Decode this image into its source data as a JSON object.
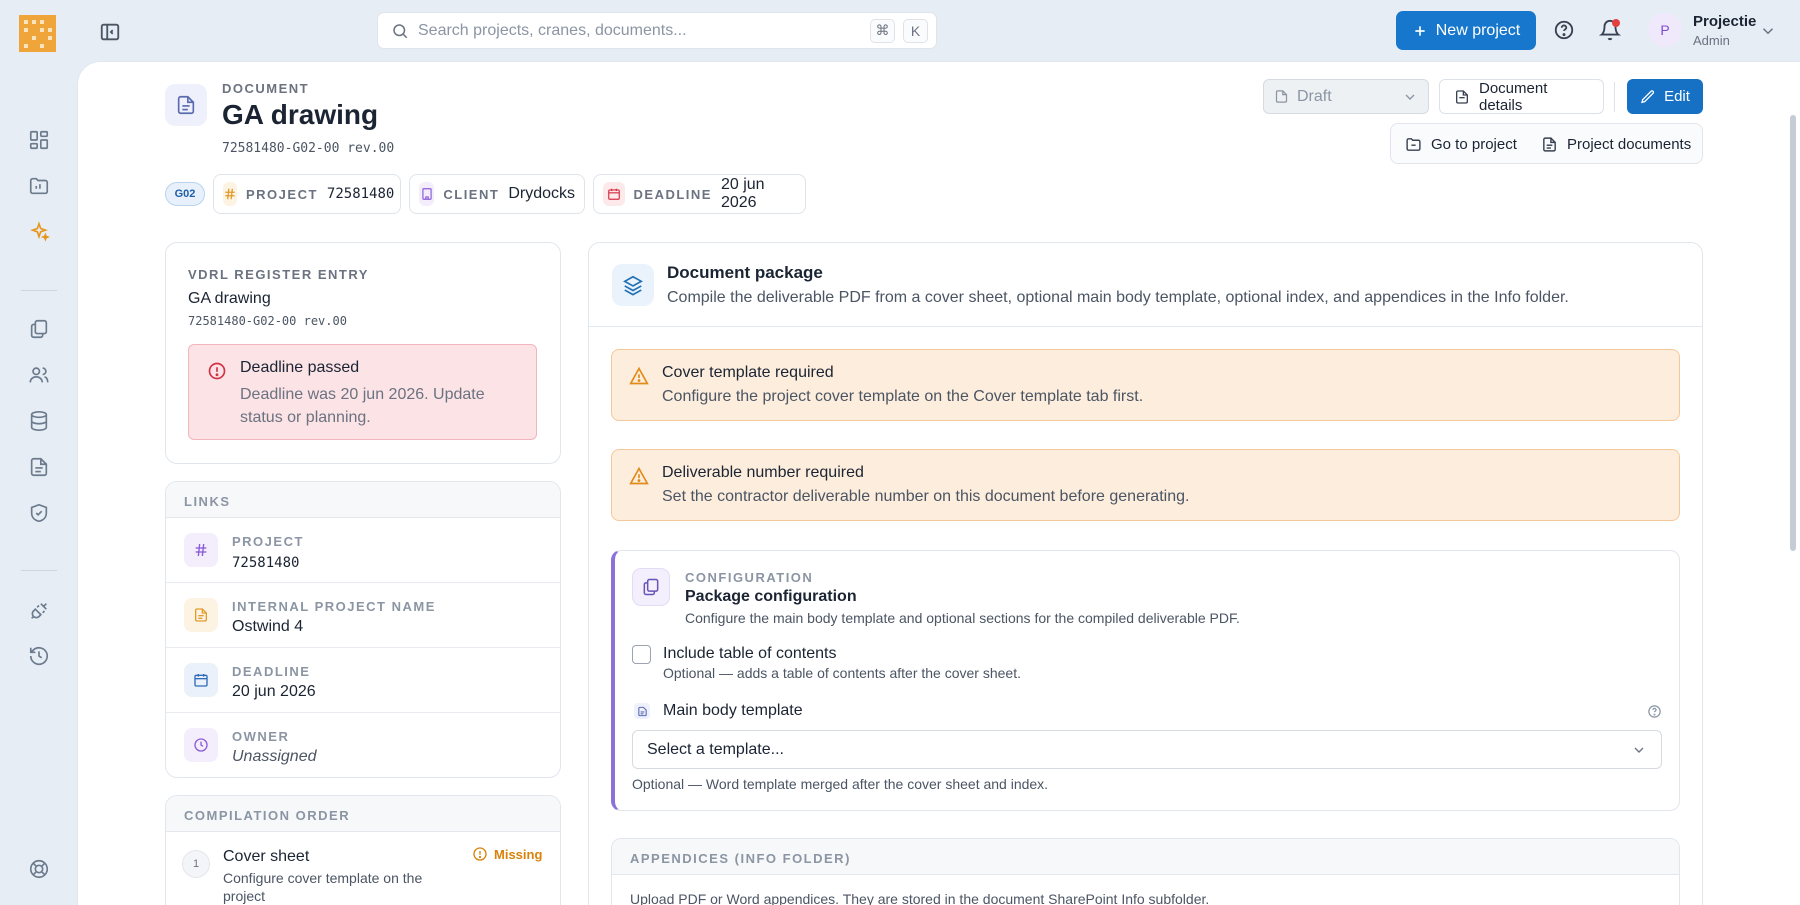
{
  "topbar": {
    "search_placeholder": "Search projects, cranes, documents...",
    "kbd_cmd": "⌘",
    "kbd_k": "K",
    "new_project_label": "New project",
    "user_initial": "P",
    "user_name": "Projectie",
    "user_role": "Admin"
  },
  "document": {
    "eyebrow": "DOCUMENT",
    "title": "GA drawing",
    "code": "72581480-G02-00 rev.00",
    "status": "Draft",
    "details_label": "Document details",
    "edit_label": "Edit",
    "goto_project_label": "Go to project",
    "project_documents_label": "Project documents"
  },
  "chips": {
    "code": "G02",
    "project_label": "PROJECT",
    "project_value": "72581480",
    "client_label": "CLIENT",
    "client_value": "Drydocks",
    "deadline_label": "DEADLINE",
    "deadline_value": "20 jun 2026"
  },
  "vdrl": {
    "eyebrow": "VDRL REGISTER ENTRY",
    "title": "GA drawing",
    "code": "72581480-G02-00 rev.00",
    "alert_title": "Deadline passed",
    "alert_desc": "Deadline was 20 jun 2026. Update status or planning."
  },
  "links": {
    "header": "LINKS",
    "items": [
      {
        "label": "PROJECT",
        "value": "72581480"
      },
      {
        "label": "INTERNAL PROJECT NAME",
        "value": "Ostwind 4"
      },
      {
        "label": "DEADLINE",
        "value": "20 jun 2026"
      },
      {
        "label": "OWNER",
        "value": "Unassigned"
      }
    ]
  },
  "compilation": {
    "header": "COMPILATION ORDER",
    "items": [
      {
        "num": "1",
        "title": "Cover sheet",
        "desc": "Configure cover template on the project",
        "status": "Missing"
      }
    ]
  },
  "package": {
    "title": "Document package",
    "desc": "Compile the deliverable PDF from a cover sheet, optional main body template, optional index, and appendices in the Info folder.",
    "alerts": [
      {
        "title": "Cover template required",
        "desc": "Configure the project cover template on the Cover template tab first."
      },
      {
        "title": "Deliverable number required",
        "desc": "Set the contractor deliverable number on this document before generating."
      }
    ]
  },
  "config": {
    "eyebrow": "CONFIGURATION",
    "title": "Package configuration",
    "desc": "Configure the main body template and optional sections for the compiled deliverable PDF.",
    "toc_label": "Include table of contents",
    "toc_desc": "Optional — adds a table of contents after the cover sheet.",
    "toc_checked": false,
    "template_label": "Main body template",
    "template_placeholder": "Select a template...",
    "template_hint": "Optional — Word template merged after the cover sheet and index."
  },
  "appendices": {
    "header": "APPENDICES (INFO FOLDER)",
    "desc": "Upload PDF or Word appendices. They are stored in the document SharePoint Info subfolder."
  },
  "colors": {
    "primary": "#1677cc",
    "danger": "#d23045",
    "warning": "#e18b1a",
    "accent": "#8a72d8"
  }
}
